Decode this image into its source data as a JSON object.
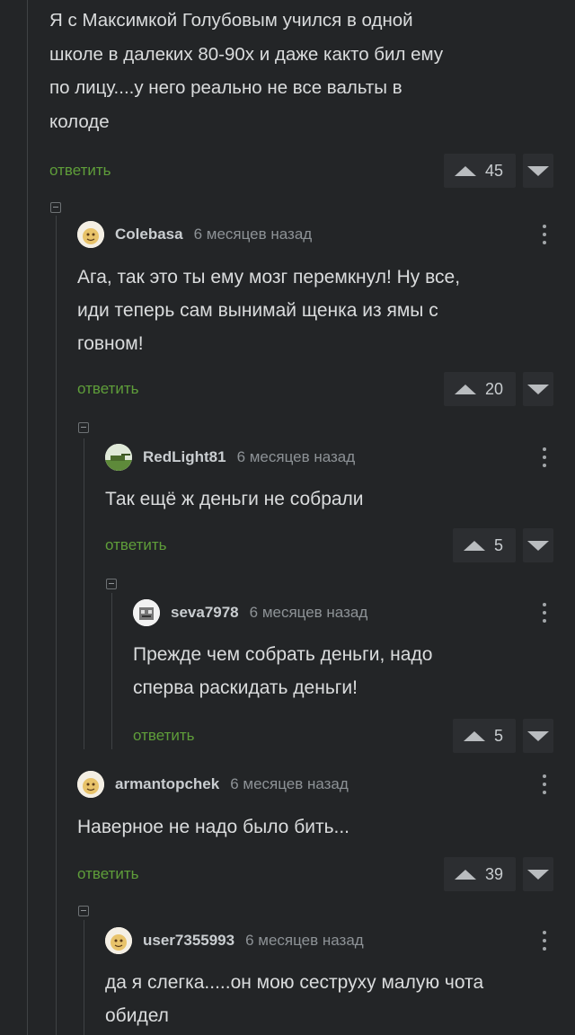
{
  "common": {
    "reply_label": "ответить",
    "time_ago": "6 месяцев назад"
  },
  "root": {
    "text": "Я с Максимкой Голубовым учился в одной\nшколе в далеких 80-90х и даже както бил ему\nпо лицу....у него реально не все вальты в\nколоде",
    "rating": "45"
  },
  "comments": [
    {
      "author": "Colebasa",
      "time": "6 месяцев назад",
      "text": "Ага, так это ты ему мозг перемкнул! Ну все,\nиди теперь сам вынимай щенка из ямы с\nговном!",
      "rating": "20",
      "reply": "ответить"
    },
    {
      "author": "RedLight81",
      "time": "6 месяцев назад",
      "text": "Так ещё ж деньги не собрали",
      "rating": "5",
      "reply": "ответить"
    },
    {
      "author": "seva7978",
      "time": "6 месяцев назад",
      "text": "Прежде чем собрать деньги, надо\nсперва раскидать деньги!",
      "rating": "5",
      "reply": "ответить"
    },
    {
      "author": "armantopchek",
      "time": "6 месяцев назад",
      "text": "Наверное не надо было бить...",
      "rating": "39",
      "reply": "ответить"
    },
    {
      "author": "user7355993",
      "time": "6 месяцев назад",
      "text": "да я слегка.....он мою сеструху малую чота\nобидел",
      "rating": "",
      "reply": ""
    }
  ],
  "colors": {
    "background": "#232527",
    "reply_green": "#5f9e3a",
    "text": "#dadcdd"
  }
}
